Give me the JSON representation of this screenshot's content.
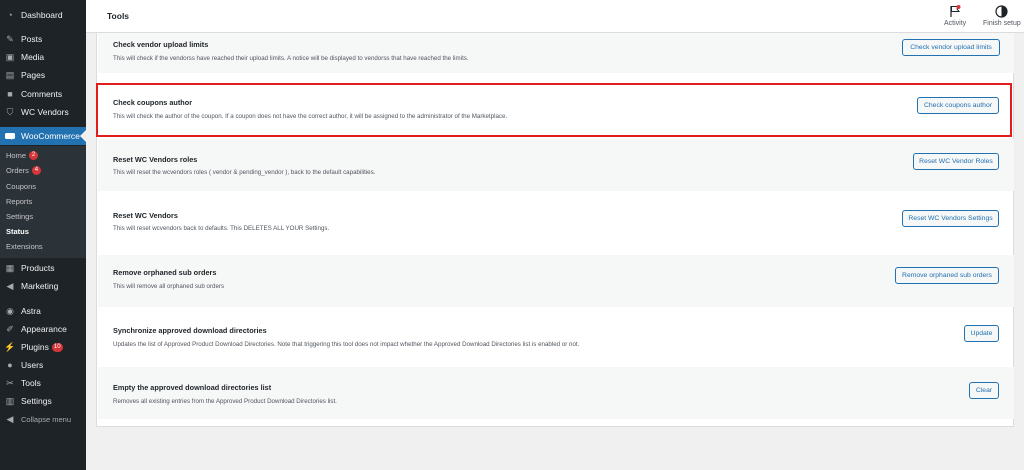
{
  "sidebar": {
    "items": [
      {
        "label": "Dashboard",
        "icon": "dashboard-icon"
      },
      {
        "label": "Posts",
        "icon": "pin-icon"
      },
      {
        "label": "Media",
        "icon": "media-icon"
      },
      {
        "label": "Pages",
        "icon": "page-icon"
      },
      {
        "label": "Comments",
        "icon": "comment-icon"
      },
      {
        "label": "WC Vendors",
        "icon": "cart-icon"
      },
      {
        "label": "WooCommerce",
        "icon": "woo-icon"
      },
      {
        "label": "Products",
        "icon": "box-icon"
      },
      {
        "label": "Marketing",
        "icon": "megaphone-icon"
      },
      {
        "label": "Astra",
        "icon": "astra-icon"
      },
      {
        "label": "Appearance",
        "icon": "brush-icon"
      },
      {
        "label": "Plugins",
        "icon": "plug-icon",
        "badge": "10"
      },
      {
        "label": "Users",
        "icon": "user-icon"
      },
      {
        "label": "Tools",
        "icon": "wrench-icon"
      },
      {
        "label": "Settings",
        "icon": "settings-icon"
      },
      {
        "label": "Collapse menu",
        "icon": "collapse-icon"
      }
    ],
    "submenu": [
      {
        "label": "Home",
        "badge": "2"
      },
      {
        "label": "Orders",
        "badge": "4"
      },
      {
        "label": "Coupons"
      },
      {
        "label": "Reports"
      },
      {
        "label": "Settings"
      },
      {
        "label": "Status"
      },
      {
        "label": "Extensions"
      }
    ]
  },
  "header": {
    "title": "Tools",
    "activity_label": "Activity",
    "finish_setup_label": "Finish setup"
  },
  "tools": [
    {
      "title": "Check vendor upload limits",
      "description": "This will check if the vendorss have reached their upload limits. A notice will be displayed to vendorss that have reached the limits.",
      "button": "Check vendor upload limits"
    },
    {
      "title": "Check coupons author",
      "description": "This will check the author of the coupon. If a coupon does not have the correct author, it will be assigned to the administrator of the Marketplace.",
      "button": "Check coupons author"
    },
    {
      "title": "Reset WC Vendors roles",
      "description": "This will reset the wcvendors roles ( vendor & pending_vendor ), back to the default capabilities.",
      "button": "Reset WC Vendor Roles"
    },
    {
      "title": "Reset WC Vendors",
      "description": "This will reset wcvendors back to defaults. This DELETES ALL YOUR Settings.",
      "button": "Reset WC Vendors Settings"
    },
    {
      "title": "Remove orphaned sub orders",
      "description": "This will remove all orphaned sub orders",
      "button": "Remove orphaned sub orders"
    },
    {
      "title": "Synchronize approved download directories",
      "description": "Updates the list of Approved Product Download Directories. Note that triggering this tool does not impact whether the Approved Download Directories list is enabled or not.",
      "button": "Update"
    },
    {
      "title": "Empty the approved download directories list",
      "description": "Removes all existing entries from the Approved Product Download Directories list.",
      "button": "Clear"
    }
  ],
  "colors": {
    "accent": "#2271b1",
    "highlight": "#e11d1d",
    "sidebar": "#1d2327",
    "badge": "#d63638"
  }
}
